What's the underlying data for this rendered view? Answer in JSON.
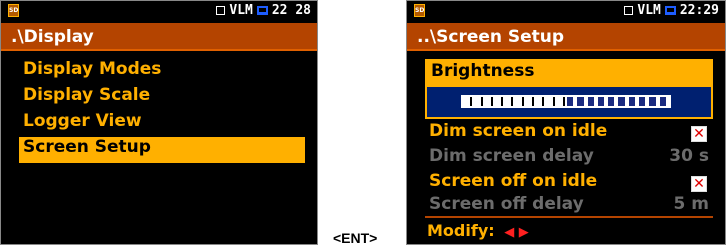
{
  "left_screen": {
    "sd_icon": "SD",
    "status_label": "VLM",
    "time": "22 28",
    "title": ".\\Display",
    "menu": [
      {
        "label": "Display Modes",
        "selected": false
      },
      {
        "label": "Display Scale",
        "selected": false
      },
      {
        "label": "Logger View",
        "selected": false
      },
      {
        "label": "Screen Setup",
        "selected": true
      }
    ]
  },
  "key_label": "<ENT>",
  "right_screen": {
    "sd_icon": "SD",
    "status_label": "VLM",
    "time": "22:29",
    "title": "..\\Screen Setup",
    "brightness": {
      "label": "Brightness",
      "level_fraction": 0.5
    },
    "settings": [
      {
        "label": "Dim screen on idle",
        "type": "checkbox",
        "checked": true,
        "active": true
      },
      {
        "label": "Dim screen delay",
        "value": "30 s",
        "active": false
      },
      {
        "label": "Screen off on idle",
        "type": "checkbox",
        "checked": true,
        "active": true
      },
      {
        "label": "Screen off delay",
        "value": "5 m",
        "active": false
      }
    ],
    "footer_label": "Modify:",
    "footer_arrows": "◀ ▶"
  },
  "colors": {
    "accent": "#ffb000",
    "title_bar": "#b44400",
    "inactive_text": "#6c6c6c",
    "slider_fill": "#1a2a80"
  }
}
